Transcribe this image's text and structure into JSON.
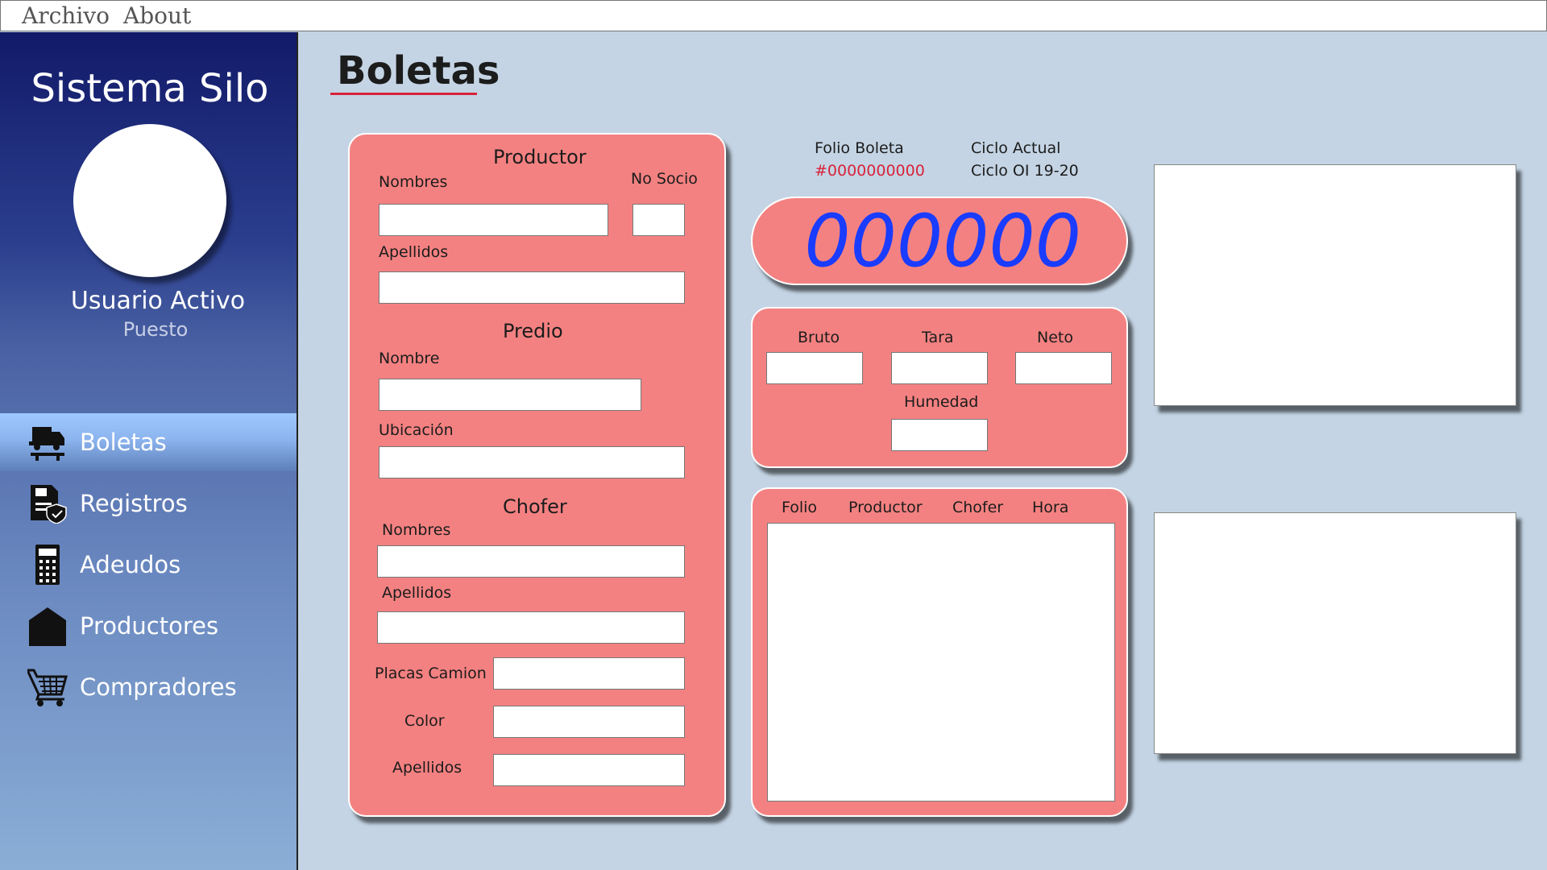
{
  "menubar": {
    "items": [
      "Archivo",
      "About"
    ]
  },
  "sidebar": {
    "app_title": "Sistema Silo",
    "user_name": "Usuario Activo",
    "user_role": "Puesto",
    "items": [
      {
        "label": "Boletas",
        "icon": "truck-scale-icon",
        "active": true
      },
      {
        "label": "Registros",
        "icon": "document-shield-icon",
        "active": false
      },
      {
        "label": "Adeudos",
        "icon": "calculator-icon",
        "active": false
      },
      {
        "label": "Productores",
        "icon": "warehouse-icon",
        "active": false
      },
      {
        "label": "Compradores",
        "icon": "shopping-cart-icon",
        "active": false
      }
    ]
  },
  "page": {
    "title": "Boletas"
  },
  "form": {
    "productor": {
      "heading": "Productor",
      "nombres_label": "Nombres",
      "no_socio_label": "No Socio",
      "apellidos_label": "Apellidos"
    },
    "predio": {
      "heading": "Predio",
      "nombre_label": "Nombre",
      "ubicacion_label": "Ubicación"
    },
    "chofer": {
      "heading": "Chofer",
      "nombres_label": "Nombres",
      "apellidos_label": "Apellidos",
      "placas_label": "Placas Camion",
      "color_label": "Color",
      "apellidos2_label": "Apellidos"
    }
  },
  "folio": {
    "label": "Folio Boleta",
    "value": "#0000000000",
    "ciclo_label": "Ciclo Actual",
    "ciclo_value": "Ciclo OI 19-20"
  },
  "counter": {
    "value": "000000"
  },
  "weights": {
    "bruto_label": "Bruto",
    "tara_label": "Tara",
    "neto_label": "Neto",
    "humedad_label": "Humedad"
  },
  "table": {
    "headers": [
      "Folio",
      "Productor",
      "Chofer",
      "Hora"
    ]
  },
  "colors": {
    "accent": "#d8233a",
    "card": "#f48181",
    "counter": "#1a3cff",
    "background": "#c4d4e4"
  }
}
